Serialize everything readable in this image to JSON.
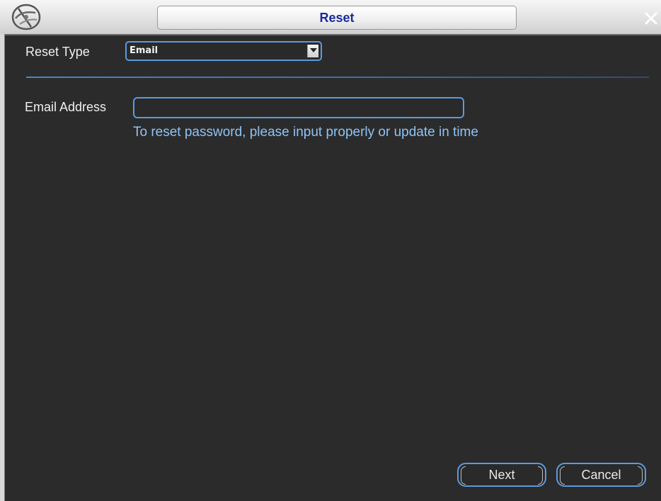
{
  "window": {
    "title": "Reset",
    "close_icon": "close-icon",
    "logo_icon": "app-logo-icon"
  },
  "form": {
    "reset_type_label": "Reset Type",
    "reset_type_value": "Email",
    "email_label": "Email Address",
    "email_value": "",
    "hint": "To reset password, please input properly or update in time"
  },
  "buttons": {
    "next": "Next",
    "cancel": "Cancel"
  },
  "colors": {
    "background": "#2b2b2b",
    "accent_border": "#5a9ae0",
    "hint_text": "#8fc3f5",
    "title_text": "#1a2a9c"
  }
}
